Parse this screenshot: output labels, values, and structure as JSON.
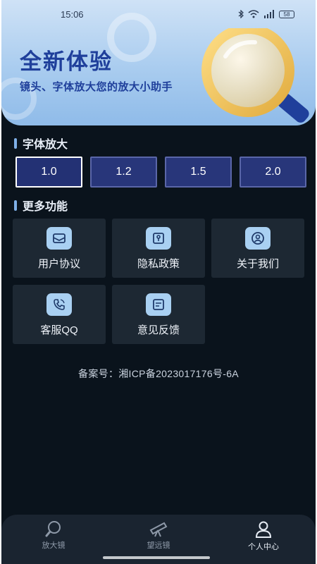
{
  "status_bar": {
    "time": "15:06",
    "battery": "58",
    "icons": [
      "bluetooth-icon",
      "wifi-icon",
      "signal-icon",
      "battery-icon"
    ]
  },
  "banner": {
    "title": "全新体验",
    "subtitle": "镜头、字体放大您的放大小助手"
  },
  "font_scale": {
    "heading": "字体放大",
    "options": [
      "1.0",
      "1.2",
      "1.5",
      "2.0"
    ],
    "selected": "1.0"
  },
  "more": {
    "heading": "更多功能",
    "items": [
      {
        "label": "用户协议",
        "icon": "mail-icon"
      },
      {
        "label": "隐私政策",
        "icon": "id-card-icon"
      },
      {
        "label": "关于我们",
        "icon": "user-circle-icon"
      },
      {
        "label": "客服QQ",
        "icon": "phone-call-icon"
      },
      {
        "label": "意见反馈",
        "icon": "feedback-doc-icon"
      }
    ]
  },
  "icp": "备案号：湘ICP备2023017176号-6A",
  "tabs": [
    {
      "label": "放大镜",
      "icon": "magnifier-icon",
      "active": false
    },
    {
      "label": "望远镜",
      "icon": "telescope-icon",
      "active": false
    },
    {
      "label": "个人中心",
      "icon": "person-icon",
      "active": true
    }
  ],
  "colors": {
    "background": "#0a131c",
    "banner_text": "#1f3f9b",
    "scale_button": "#28367a",
    "card": "#1d2833",
    "icon_tile": "#a9d0f2",
    "tab_bar": "#1a2430"
  }
}
